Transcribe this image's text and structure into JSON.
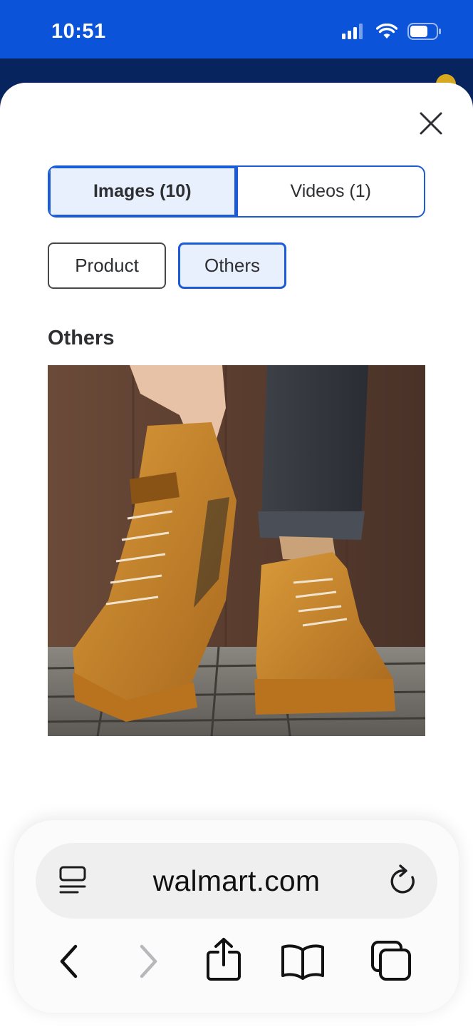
{
  "status_bar": {
    "time": "10:51"
  },
  "modal": {
    "media_tabs": [
      {
        "label": "Images (10)",
        "active": true
      },
      {
        "label": "Videos (1)",
        "active": false
      }
    ],
    "filters": [
      {
        "label": "Product",
        "active": false
      },
      {
        "label": "Others",
        "active": true
      }
    ],
    "section_title": "Others"
  },
  "browser": {
    "url": "walmart.com"
  },
  "colors": {
    "accent": "#1b5bd8",
    "status_bar": "#0b53d9",
    "active_fill": "#e8effd"
  },
  "icons": [
    "signal-icon",
    "wifi-icon",
    "battery-icon",
    "close-icon",
    "reader-icon",
    "reload-icon",
    "back-icon",
    "forward-icon",
    "share-icon",
    "bookmarks-icon",
    "tabs-icon"
  ]
}
